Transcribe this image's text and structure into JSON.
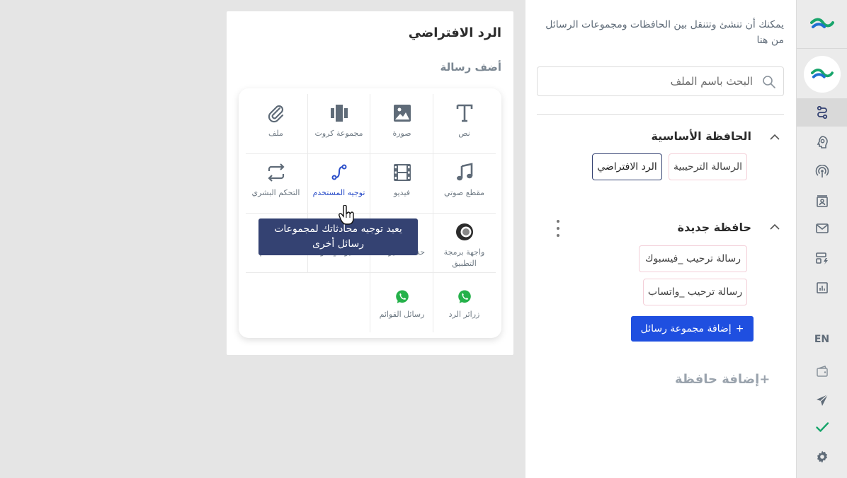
{
  "rail": {
    "language": "EN",
    "items": [
      {
        "icon": "flow-icon",
        "active": true
      },
      {
        "icon": "brain-icon"
      },
      {
        "icon": "broadcast-icon"
      },
      {
        "icon": "contact-card-icon"
      },
      {
        "icon": "mail-icon"
      },
      {
        "icon": "template-icon"
      },
      {
        "icon": "analytics-icon"
      },
      {
        "icon": "wallet-icon"
      },
      {
        "icon": "send-icon"
      },
      {
        "icon": "check-icon"
      },
      {
        "icon": "settings-icon"
      }
    ],
    "colors": {
      "brand_green": "#18a56b",
      "brand_blue": "#1f6fd1"
    }
  },
  "folders": {
    "intro": "يمكنك أن تنشئ وتتنقل بين الحافظات ومجموعات الرسائل من هنا",
    "search_placeholder": "البحث باسم الملف",
    "main_folder": {
      "title": "الحافظة الأساسية",
      "chips": [
        "الرسالة الترحيبية",
        "الرد الافتراضي"
      ],
      "selected": "الرد الافتراضي"
    },
    "new_folder": {
      "title": "حافظة جديدة",
      "chips": [
        "رسالة ترحيب _فيسبوك",
        "رسالة ترحيب _واتساب"
      ]
    },
    "add_group_label": "إضافة مجموعة رسائل",
    "add_group_plus": "+",
    "add_folder_label": "إضافة حافظة",
    "add_folder_plus": "+"
  },
  "card": {
    "title": "الرد الافتراضي",
    "subtitle": "أضف رسالة",
    "cells": [
      {
        "label": "نص",
        "icon": "text-icon"
      },
      {
        "label": "صورة",
        "icon": "image-icon"
      },
      {
        "label": "مجموعة كروت",
        "icon": "cards-icon"
      },
      {
        "label": "ملف",
        "icon": "paperclip-icon"
      },
      {
        "label": "مقطع صوتي",
        "icon": "music-icon"
      },
      {
        "label": "فيديو",
        "icon": "film-icon"
      },
      {
        "label": "توجيه المستخدم",
        "icon": "route-icon"
      },
      {
        "label": "التحكم البشري",
        "icon": "repeat-icon"
      },
      {
        "label": "واجهة برمجة التطبيق",
        "icon": "api-icon"
      },
      {
        "label": "حدد المتغيرات",
        "icon": "variable-icon"
      },
      {
        "label": "تأخير في الرد",
        "icon": "delay-icon"
      },
      {
        "label": "المستخدم",
        "icon": "user-icon"
      },
      {
        "label": "زرائر الرد",
        "icon": "whatsapp-icon"
      },
      {
        "label": "رسائل القوائم",
        "icon": "whatsapp-icon"
      }
    ],
    "tooltip": "يعيد توجيه محادثاتك لمجموعات رسائل أخرى",
    "colors": {
      "icon_gray": "#5f6b78",
      "highlight": "#2c4fc9",
      "tooltip_bg": "#344272",
      "whatsapp": "#25b14a"
    }
  }
}
